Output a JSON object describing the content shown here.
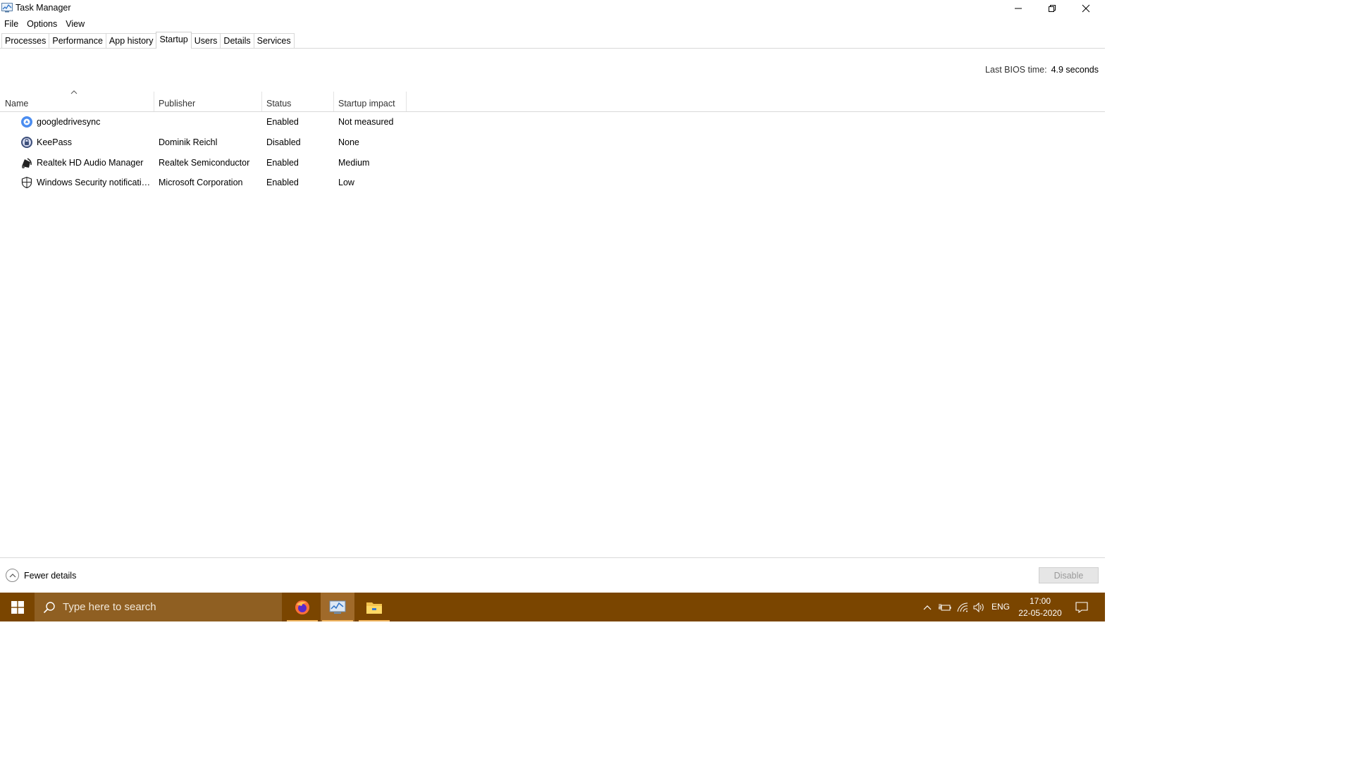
{
  "window": {
    "title": "Task Manager"
  },
  "menu": [
    "File",
    "Options",
    "View"
  ],
  "tabs": [
    "Processes",
    "Performance",
    "App history",
    "Startup",
    "Users",
    "Details",
    "Services"
  ],
  "active_tab": "Startup",
  "bios": {
    "label": "Last BIOS time:",
    "value": "4.9 seconds"
  },
  "columns": {
    "name": "Name",
    "publisher": "Publisher",
    "status": "Status",
    "impact": "Startup impact"
  },
  "rows": [
    {
      "icon": "google-drive-icon",
      "name": "googledrivesync",
      "publisher": "",
      "status": "Enabled",
      "impact": "Not measured"
    },
    {
      "icon": "keepass-icon",
      "name": "KeePass",
      "publisher": "Dominik Reichl",
      "status": "Disabled",
      "impact": "None"
    },
    {
      "icon": "realtek-audio-icon",
      "name": "Realtek HD Audio Manager",
      "publisher": "Realtek Semiconductor",
      "status": "Enabled",
      "impact": "Medium"
    },
    {
      "icon": "windows-security-icon",
      "name": "Windows Security notificatio...",
      "publisher": "Microsoft Corporation",
      "status": "Enabled",
      "impact": "Low"
    }
  ],
  "footer": {
    "fewer_details": "Fewer details",
    "disable": "Disable"
  },
  "taskbar": {
    "search_placeholder": "Type here to search",
    "language": "ENG",
    "time": "17:00",
    "date": "22-05-2020",
    "apps": [
      "firefox-icon",
      "task-manager-icon",
      "file-explorer-icon"
    ]
  },
  "colors": {
    "taskbar": "#7a4500",
    "search_box": "#8f5f22",
    "active_app": "#a06a2a"
  }
}
